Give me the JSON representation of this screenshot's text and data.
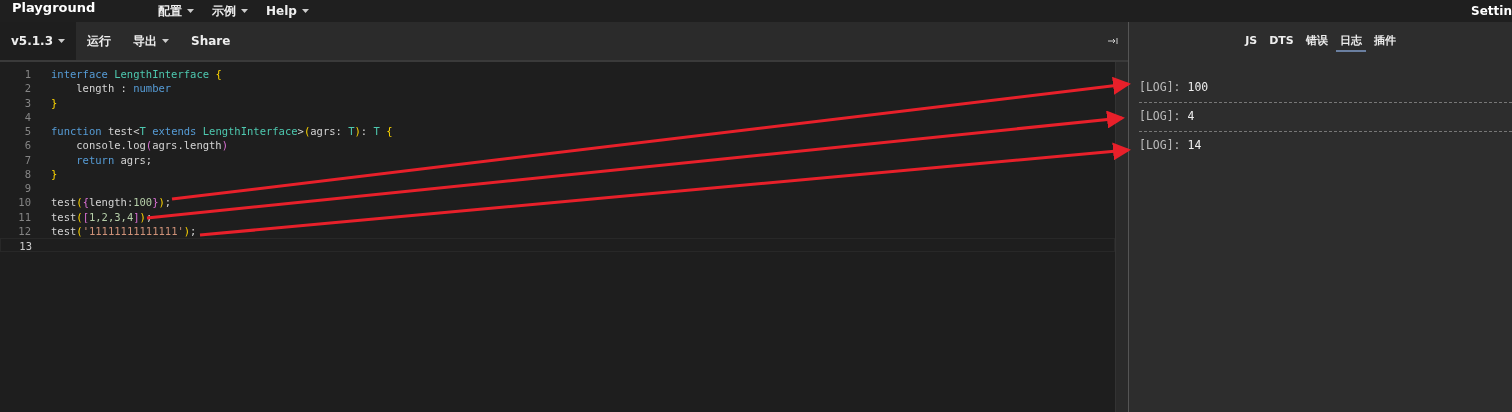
{
  "header": {
    "title": "Playground",
    "menus": [
      {
        "label": "配置",
        "dropdown": true
      },
      {
        "label": "示例",
        "dropdown": true
      },
      {
        "label": "Help",
        "dropdown": true
      }
    ],
    "settings": "Settin"
  },
  "toolbar": {
    "items": [
      {
        "label": "v5.1.3",
        "dropdown": true,
        "selected": true
      },
      {
        "label": "运行",
        "dropdown": false,
        "selected": false
      },
      {
        "label": "导出",
        "dropdown": true,
        "selected": false
      },
      {
        "label": "Share",
        "dropdown": false,
        "selected": false
      }
    ]
  },
  "editor": {
    "lines": [
      {
        "number": "1",
        "current": false,
        "tokens": [
          {
            "text": "interface ",
            "kind": "keyword"
          },
          {
            "text": "LengthInterface ",
            "kind": "type"
          },
          {
            "text": "{",
            "kind": "brace"
          }
        ]
      },
      {
        "number": "2",
        "current": false,
        "tokens": [
          {
            "text": "    length : ",
            "kind": "plain"
          },
          {
            "text": "number",
            "kind": "keyword"
          }
        ]
      },
      {
        "number": "3",
        "current": false,
        "tokens": [
          {
            "text": "}",
            "kind": "brace"
          }
        ]
      },
      {
        "number": "4",
        "current": false
      },
      {
        "number": "5",
        "current": false,
        "tokens": [
          {
            "text": "function",
            "kind": "keyword"
          },
          {
            "text": " test<",
            "kind": "plain"
          },
          {
            "text": "T ",
            "kind": "type"
          },
          {
            "text": "extends ",
            "kind": "keyword"
          },
          {
            "text": "LengthInterface",
            "kind": "type"
          },
          {
            "text": ">",
            "kind": "plain"
          },
          {
            "text": "(",
            "kind": "brace"
          },
          {
            "text": "agrs: ",
            "kind": "plain"
          },
          {
            "text": "T",
            "kind": "type"
          },
          {
            "text": ")",
            "kind": "brace"
          },
          {
            "text": ": ",
            "kind": "plain"
          },
          {
            "text": "T ",
            "kind": "type"
          },
          {
            "text": "{",
            "kind": "brace"
          }
        ]
      },
      {
        "number": "6",
        "current": false,
        "tokens": [
          {
            "text": "    console.log",
            "kind": "plain"
          },
          {
            "text": "(",
            "kind": "brace2"
          },
          {
            "text": "agrs.length",
            "kind": "plain"
          },
          {
            "text": ")",
            "kind": "brace2"
          }
        ]
      },
      {
        "number": "7",
        "current": false,
        "tokens": [
          {
            "text": "    return",
            "kind": "keyword"
          },
          {
            "text": " agrs;",
            "kind": "plain"
          }
        ]
      },
      {
        "number": "8",
        "current": false,
        "tokens": [
          {
            "text": "}",
            "kind": "brace"
          }
        ]
      },
      {
        "number": "9",
        "current": false
      },
      {
        "number": "10",
        "current": false,
        "tokens": [
          {
            "text": "test",
            "kind": "plain"
          },
          {
            "text": "(",
            "kind": "brace"
          },
          {
            "text": "{",
            "kind": "brace2"
          },
          {
            "text": "length:",
            "kind": "plain"
          },
          {
            "text": "100",
            "kind": "number"
          },
          {
            "text": "}",
            "kind": "brace2"
          },
          {
            "text": ")",
            "kind": "brace"
          },
          {
            "text": ";",
            "kind": "plain"
          }
        ]
      },
      {
        "number": "11",
        "current": false,
        "tokens": [
          {
            "text": "test",
            "kind": "plain"
          },
          {
            "text": "(",
            "kind": "brace"
          },
          {
            "text": "[",
            "kind": "brace2"
          },
          {
            "text": "1,2,3,4",
            "kind": "number"
          },
          {
            "text": "]",
            "kind": "brace2"
          },
          {
            "text": ")",
            "kind": "brace"
          },
          {
            "text": ";",
            "kind": "plain"
          }
        ]
      },
      {
        "number": "12",
        "current": false,
        "tokens": [
          {
            "text": "test",
            "kind": "plain"
          },
          {
            "text": "(",
            "kind": "brace"
          },
          {
            "text": "'11111111111111'",
            "kind": "string"
          },
          {
            "text": ")",
            "kind": "brace"
          },
          {
            "text": ";",
            "kind": "plain"
          }
        ]
      },
      {
        "number": "13",
        "current": true
      }
    ]
  },
  "output": {
    "tabs": [
      {
        "label": "JS",
        "selected": false
      },
      {
        "label": "DTS",
        "selected": false
      },
      {
        "label": "错误",
        "selected": false
      },
      {
        "label": "日志",
        "selected": true
      },
      {
        "label": "插件",
        "selected": false
      }
    ],
    "logs": [
      {
        "tag": "[LOG]:",
        "value": "100"
      },
      {
        "tag": "[LOG]:",
        "value": "4"
      },
      {
        "tag": "[LOG]:",
        "value": "14"
      }
    ]
  }
}
